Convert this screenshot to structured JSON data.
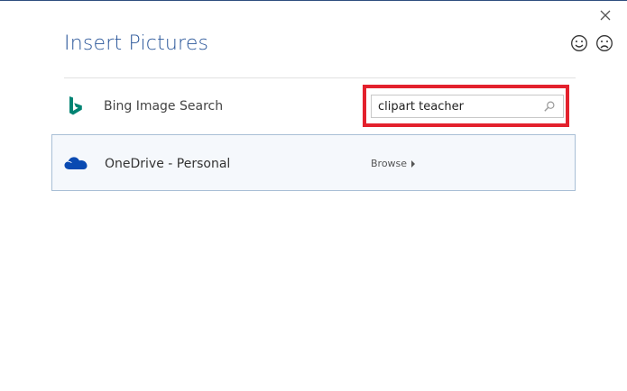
{
  "dialog": {
    "title": "Insert Pictures"
  },
  "sources": {
    "bing": {
      "label": "Bing Image Search",
      "search_value": "clipart teacher"
    },
    "onedrive": {
      "label": "OneDrive - Personal",
      "browse_label": "Browse"
    }
  },
  "colors": {
    "title": "#2b579a",
    "highlight": "#e3212d",
    "bing": "#008373",
    "onedrive": "#094ab2",
    "selected_row_bg": "#f5f8fc",
    "selected_row_border": "#a9bfd6"
  },
  "icons": {
    "close": "close-icon",
    "smile": "smile-icon",
    "frown": "frown-icon",
    "bing": "bing-logo-icon",
    "search": "search-icon",
    "onedrive": "onedrive-cloud-icon",
    "browse": "chevron-right-icon"
  }
}
